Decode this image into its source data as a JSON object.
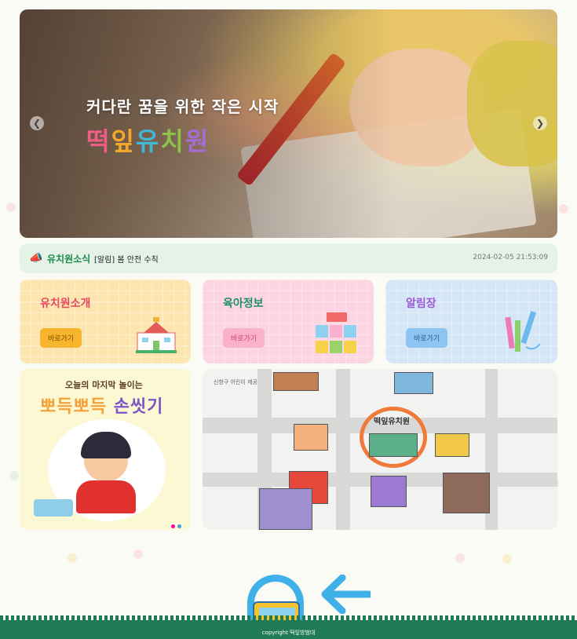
{
  "hero": {
    "subtitle": "커다란 꿈을 위한 작은 시작",
    "title_chars": [
      "떡",
      "잎",
      "유",
      "치",
      "원"
    ],
    "prev_icon": "chevron-left-icon",
    "next_icon": "chevron-right-icon"
  },
  "news": {
    "label": "유치원소식",
    "headline": "[알림] 봄 안전 수칙",
    "date": "2024-02-05 21:53:09",
    "icon": "megaphone-icon"
  },
  "cards": [
    {
      "title": "유치원소개",
      "button": "바로가기",
      "icon": "school-icon",
      "color": "#fde5b0"
    },
    {
      "title": "육아정보",
      "button": "바로가기",
      "icon": "blocks-icon",
      "color": "#fcd4e2"
    },
    {
      "title": "알림장",
      "button": "바로가기",
      "icon": "crayons-icon",
      "color": "#d5e6f7"
    }
  ],
  "promo": {
    "line1": "오늘의 마지막 놀이는",
    "line2a": "뽀득뽀득",
    "line2b": "손씻기"
  },
  "map": {
    "caption": "신항구 어린이 제공",
    "target_label": "떡잎유치원"
  },
  "footer": {
    "copyright": "copyright 떡잎방범대",
    "colors": {
      "grass": "#1f7a55",
      "bus": "#f3c22c",
      "arch": "#3fb0e8"
    }
  }
}
